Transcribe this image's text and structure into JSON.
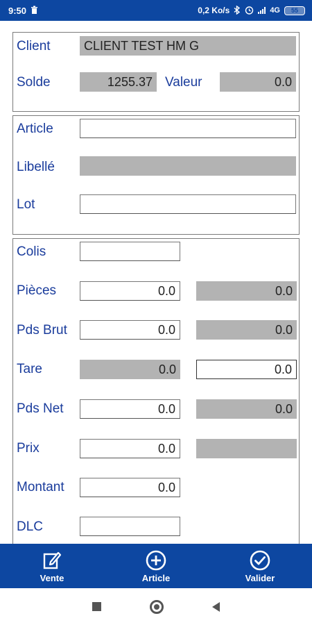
{
  "status_bar": {
    "time": "9:50",
    "network_speed": "0,2 Ko/s",
    "network_type": "4G",
    "battery": "55",
    "icons": [
      "trash-icon",
      "bluetooth-icon",
      "alarm-icon",
      "signal-icon",
      "battery-icon"
    ]
  },
  "client_panel": {
    "client_label": "Client",
    "client_value": "CLIENT TEST HM G",
    "solde_label": "Solde",
    "solde_value": "1255.37",
    "valeur_label": "Valeur",
    "valeur_value": "0.0"
  },
  "article_panel": {
    "article_label": "Article",
    "article_value": "",
    "libelle_label": "Libellé",
    "libelle_value": "",
    "lot_label": "Lot",
    "lot_value": ""
  },
  "quantity_panel": {
    "colis_label": "Colis",
    "colis_value": "",
    "pieces_label": "Pièces",
    "pieces_value": "0.0",
    "pieces_ref": "0.0",
    "pds_brut_label": "Pds Brut",
    "pds_brut_value": "0.0",
    "pds_brut_ref": "0.0",
    "tare_label": "Tare",
    "tare_ref": "0.0",
    "tare_value": "0.0",
    "pds_net_label": "Pds Net",
    "pds_net_value": "0.0",
    "pds_net_ref": "0.0",
    "prix_label": "Prix",
    "prix_value": "0.0",
    "prix_ref": "",
    "montant_label": "Montant",
    "montant_value": "0.0",
    "dlc_label": "DLC",
    "dlc_value": ""
  },
  "action_bar": {
    "vente_label": "Vente",
    "article_label": "Article",
    "valider_label": "Valider"
  },
  "colors": {
    "primary": "#0d47a1",
    "label_text": "#1a3c9c",
    "readonly_field": "#b3b3b3"
  }
}
